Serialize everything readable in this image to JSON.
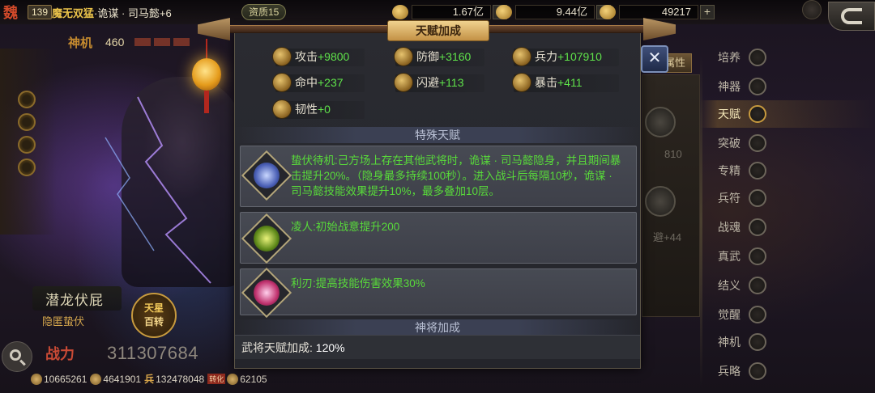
{
  "header": {
    "faction": "魏",
    "level": "139",
    "hero_nick": "魔无双猛",
    "hero_name": "·诡谋 · 司马懿+6",
    "aptitude": "资质15",
    "resources": [
      {
        "icon": "wheat-icon",
        "value": "1.67亿",
        "plus": "+"
      },
      {
        "icon": "coin-icon",
        "value": "9.44亿",
        "plus": "+"
      },
      {
        "icon": "ingot-icon",
        "value": "49217",
        "plus": "+"
      }
    ]
  },
  "hero_panel": {
    "shenji_label": "神机",
    "shenji_value": "460",
    "title_text": "潜龙伏屁",
    "subtitle": "隐匿蛰伏",
    "star_button_line1": "天星",
    "star_button_line2": "百转",
    "power_label": "战力",
    "power_value": "311307684",
    "bottom_stats": [
      {
        "icon": "gold-icon",
        "prefix": "",
        "value": "10665261"
      },
      {
        "icon": "gold-icon",
        "prefix": "",
        "value": "4641901"
      },
      {
        "icon": "soldier-icon",
        "prefix": "兵",
        "value": "132478048"
      },
      {
        "icon": "gold-icon",
        "prefix": "",
        "value": "62105",
        "tag": "转化"
      }
    ]
  },
  "modal": {
    "title": "天赋加成",
    "close_glyph": "✕",
    "stats": [
      {
        "name": "攻击",
        "value": "+9800"
      },
      {
        "name": "防御",
        "value": "+3160"
      },
      {
        "name": "兵力",
        "value": "+107910"
      },
      {
        "name": "命中",
        "value": "+237"
      },
      {
        "name": "闪避",
        "value": "+113"
      },
      {
        "name": "暴击",
        "value": "+411"
      },
      {
        "name": "韧性",
        "value": "+0"
      }
    ],
    "special_header": "特殊天赋",
    "talents": [
      {
        "text": "蛰伏待机:己方场上存在其他武将时，诡谋 · 司马懿隐身，并且期间暴击提升20%。（隐身最多持续100秒）。进入战斗后每隔10秒，诡谋 · 司马懿技能效果提升10%，最多叠加10层。"
      },
      {
        "text": "凌人:初始战意提升200"
      },
      {
        "text": "利刃:提高技能伤害效果30%"
      }
    ],
    "bonus_header": "神将加成",
    "bonus_label": "武将天赋加成:",
    "bonus_value": "120%"
  },
  "underlying": {
    "tab_label": "属性",
    "value1": "810",
    "value2": "避+44"
  },
  "sidebar": {
    "items": [
      {
        "label": "培养",
        "icon": "cultivate-icon"
      },
      {
        "label": "神器",
        "icon": "artifact-icon"
      },
      {
        "label": "天赋",
        "icon": "talent-icon",
        "active": true
      },
      {
        "label": "突破",
        "icon": "breakthrough-icon"
      },
      {
        "label": "专精",
        "icon": "mastery-icon"
      },
      {
        "label": "兵符",
        "icon": "tally-icon"
      },
      {
        "label": "战魂",
        "icon": "warsoul-icon"
      },
      {
        "label": "真武",
        "icon": "zhenwu-icon"
      },
      {
        "label": "结义",
        "icon": "oath-icon"
      },
      {
        "label": "觉醒",
        "icon": "awaken-icon"
      },
      {
        "label": "神机",
        "icon": "divine-mech-icon"
      },
      {
        "label": "兵略",
        "icon": "strategy-icon"
      }
    ]
  }
}
